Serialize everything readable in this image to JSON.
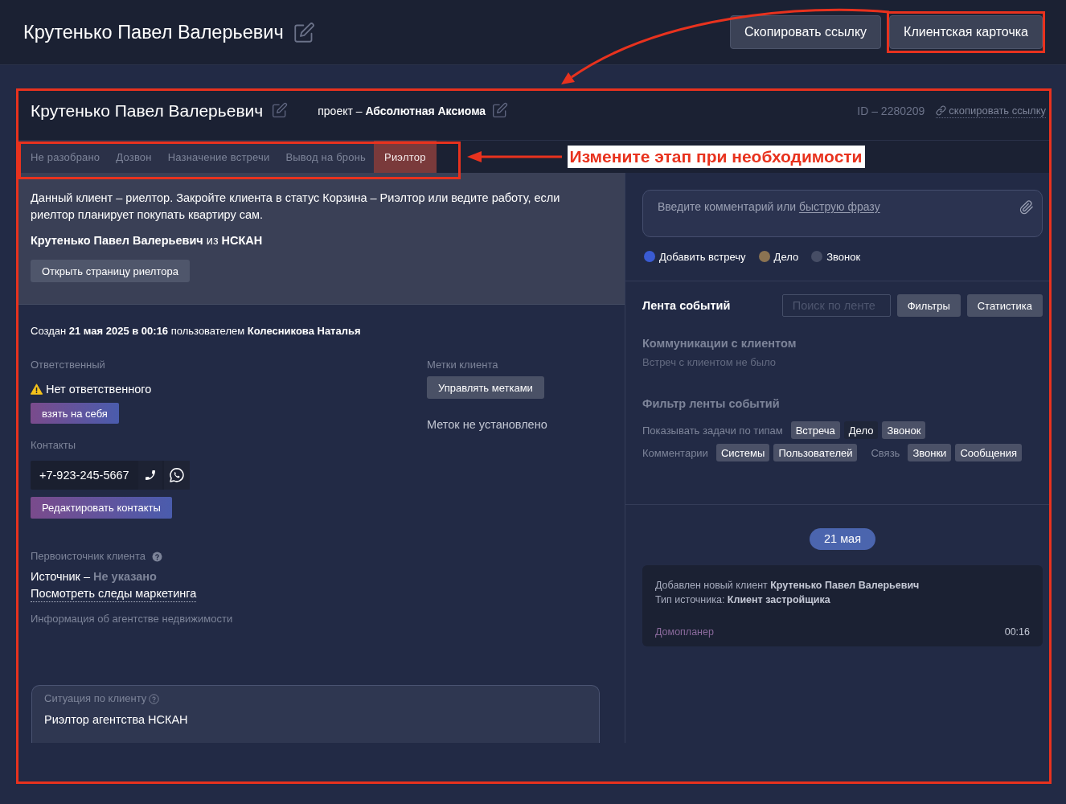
{
  "header": {
    "title": "Крутенько Павел Валерьевич",
    "buttons": [
      {
        "label": "Скопировать ссылку",
        "highlighted": false
      },
      {
        "label": "Клиентская карточка",
        "highlighted": true
      }
    ]
  },
  "card": {
    "highlighted": true,
    "name": "Крутенько Павел Валерьевич",
    "project": "проект – **Абсолютная Аксиома**",
    "id": "ID – 2280209",
    "copy_link": "скопировать ссылку"
  },
  "stages": {
    "highlighted": true,
    "items": [
      {
        "label": "Не разобрано",
        "selected": false
      },
      {
        "label": "Дозвон",
        "selected": false
      },
      {
        "label": "Назначение встречи",
        "selected": false
      },
      {
        "label": "Вывод на бронь",
        "selected": false
      },
      {
        "label": "Риэлтор",
        "selected": true
      }
    ]
  },
  "callout": "Измените этап при необходимости",
  "notice": {
    "text": "Данный клиент – риелтор. Закройте клиента в статус Корзина – Риэлтор или ведите работу, если риелтор планирует покупать квартиру сам.",
    "realtor": "**Крутенько Павел Валерьевич** из **НСКАН**",
    "button": "Открыть страницу риелтора"
  },
  "details": {
    "created": "Создан **21 мая 2025 в 00:16** пользователем **Колесникова Наталья**",
    "responsible_label": "Ответственный",
    "responsible_value": "Нет ответственного",
    "take_button": "взять на себя",
    "contacts_label": "Контакты",
    "phone": "+7-923-245-5667",
    "edit_contacts_button": "Редактировать контакты",
    "source_label": "Первоисточник клиента",
    "source": "Источник – **Не указано**",
    "marketing_link": "Посмотреть следы маркетинга",
    "agency_label": "Информация об агентстве недвижимости",
    "tags_label": "Метки клиента",
    "tags_button": "Управлять метками",
    "tags_empty": "Меток не установлено"
  },
  "situation": {
    "label": "Ситуация по клиенту",
    "value": "Риэлтор агентства НСКАН"
  },
  "comment": {
    "placeholder": "Введите комментарий или",
    "link": "быструю фразу"
  },
  "event_types": [
    {
      "label": "Добавить встречу",
      "color": "#3a5bd3"
    },
    {
      "label": "Дело",
      "color": "#8b7352"
    },
    {
      "label": "Звонок",
      "color": "#464d65"
    }
  ],
  "feed": {
    "title": "Лента событий",
    "search_placeholder": "Поиск по ленте",
    "buttons": [
      "Фильтры",
      "Статистика"
    ],
    "communications_title": "Коммуникации с клиентом",
    "communications_empty": "Встреч с клиентом не было",
    "filter_title": "Фильтр ленты событий",
    "filter_rows": [
      {
        "groups": [
          {
            "label": "Показывать задачи по типам",
            "chips": [
              {
                "label": "Встреча",
                "selected": true
              },
              {
                "label": "Дело",
                "selected": false
              },
              {
                "label": "Звонок",
                "selected": true
              }
            ]
          }
        ]
      },
      {
        "groups": [
          {
            "label": "Комментарии",
            "chips": [
              {
                "label": "Системы",
                "selected": true
              },
              {
                "label": "Пользователей",
                "selected": true
              }
            ]
          },
          {
            "label": "Связь",
            "chips": [
              {
                "label": "Звонки",
                "selected": true
              },
              {
                "label": "Сообщения",
                "selected": true
              }
            ]
          }
        ]
      }
    ]
  },
  "timeline": {
    "date": "21 мая",
    "events": [
      {
        "lines": [
          "Добавлен новый клиент **Крутенько Павел Валерьевич**",
          "Тип источника: **Клиент застройщика**"
        ],
        "author": "Домопланер",
        "time": "00:16"
      }
    ]
  }
}
